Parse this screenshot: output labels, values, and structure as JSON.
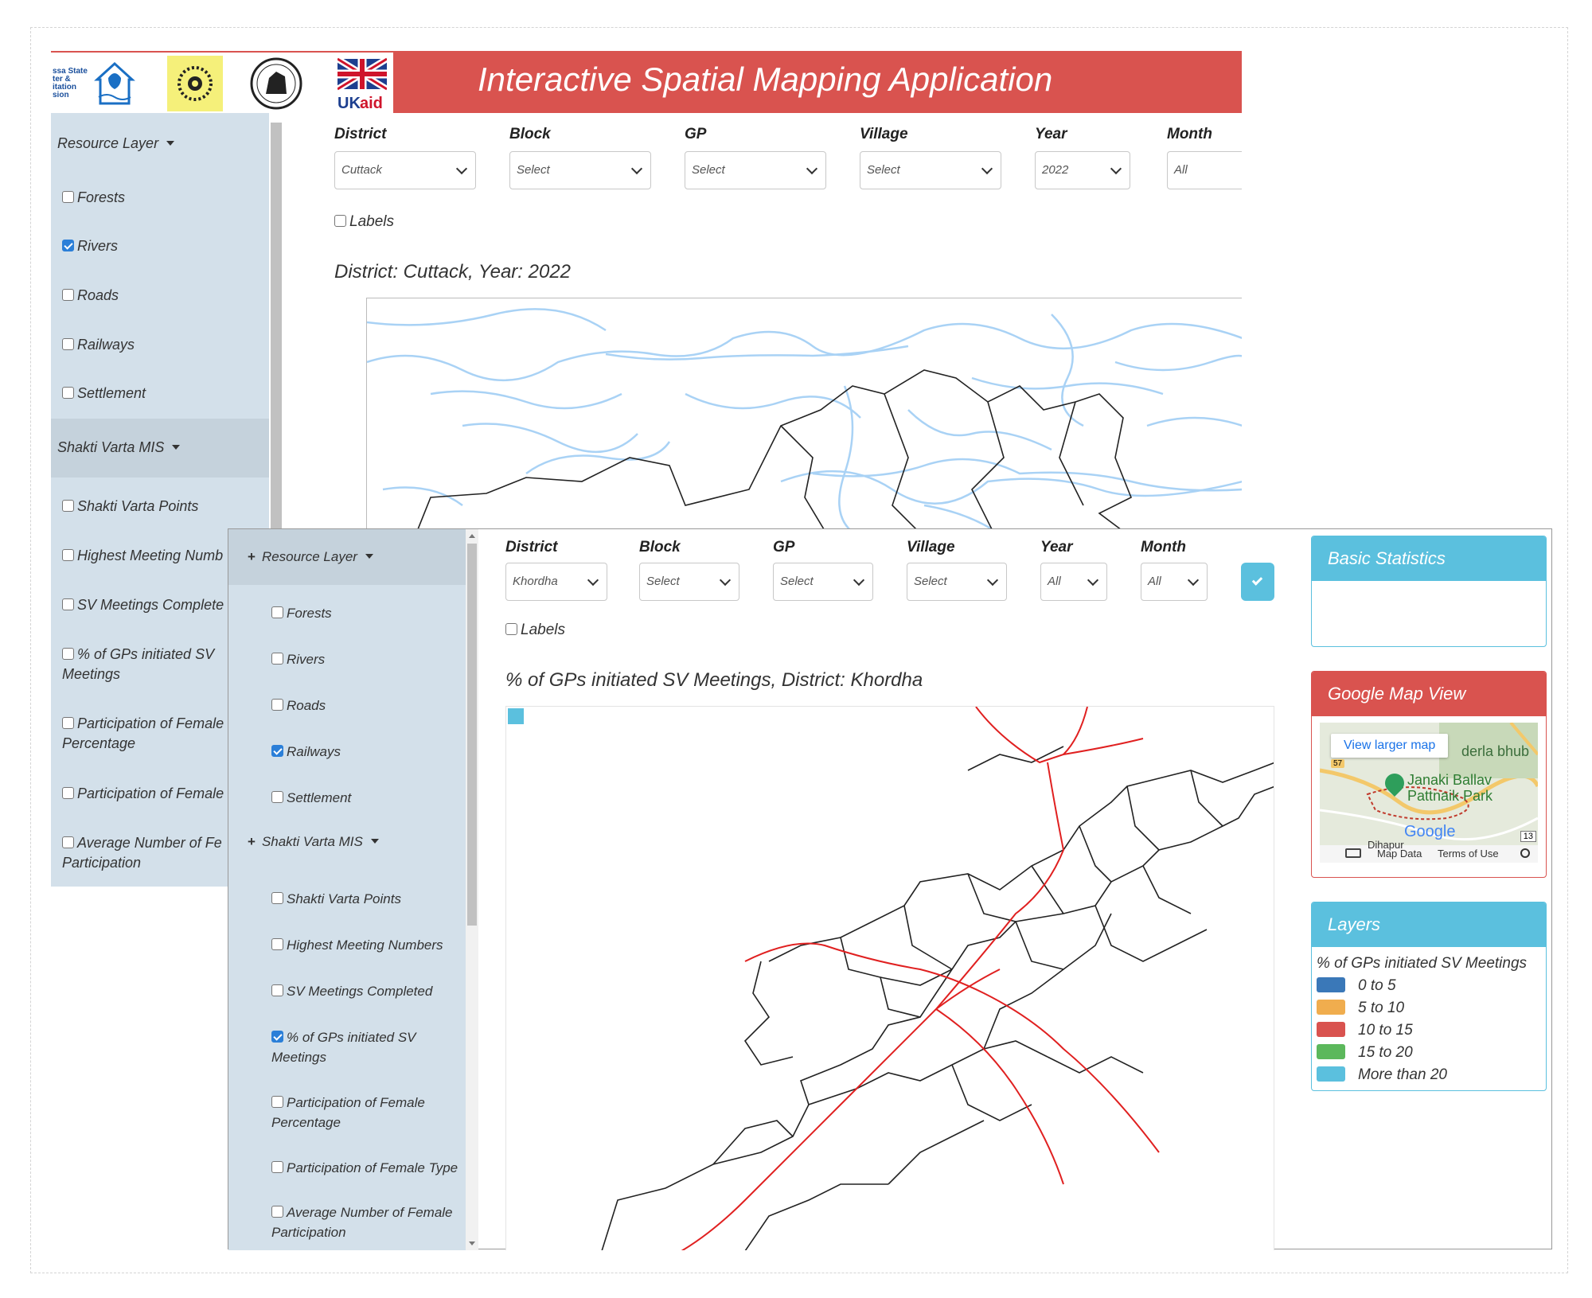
{
  "app": {
    "title": "Interactive Spatial Mapping Application",
    "logo_text": "ssa State ter & itation sion",
    "ukaid_text": "UKaid"
  },
  "back": {
    "filters": {
      "labels": [
        "District",
        "Block",
        "GP",
        "Village",
        "Year",
        "Month"
      ],
      "values": [
        "Cuttack",
        "Select",
        "Select",
        "Select",
        "2022",
        "All"
      ]
    },
    "labels_toggle": "Labels",
    "map_title": "District: Cuttack, Year: 2022",
    "sidebar": {
      "resource_header": "Resource Layer",
      "resource_items": [
        "Forests",
        "Rivers",
        "Roads",
        "Railways",
        "Settlement"
      ],
      "shakti_header": "Shakti Varta MIS",
      "shakti_items": [
        "Shakti Varta Points",
        "Highest Meeting Numb",
        "SV Meetings Complete",
        "% of GPs initiated SV",
        "Meetings",
        "Participation of Female",
        "Percentage",
        "Participation of Female",
        "Average Number of Fe",
        "Participation"
      ]
    }
  },
  "front": {
    "filters": {
      "labels": [
        "District",
        "Block",
        "GP",
        "Village",
        "Year",
        "Month"
      ],
      "values": [
        "Khordha",
        "Select",
        "Select",
        "Select",
        "All",
        "All"
      ]
    },
    "labels_toggle": "Labels",
    "map_title": "% of GPs initiated SV Meetings, District: Khordha",
    "sidebar": {
      "resource_header": "Resource Layer",
      "resource_items": [
        "Forests",
        "Rivers",
        "Roads",
        "Railways",
        "Settlement"
      ],
      "shakti_header": "Shakti Varta MIS",
      "shakti_items": [
        "Shakti Varta Points",
        "Highest Meeting Numbers",
        "SV Meetings Completed",
        "% of GPs initiated SV",
        "Meetings",
        "Participation of Female",
        "Percentage",
        "Participation of Female Type",
        "Average Number of Female",
        "Participation"
      ]
    },
    "stats": {
      "title": "Basic Statistics"
    },
    "gmap": {
      "title": "Google Map View",
      "view_larger": "View larger map",
      "place1": "derla bhub",
      "place2": "Janaki Ballav",
      "place3": "Pattnaik Park",
      "google": "Google",
      "place4": "Dihapur",
      "map_data": "Map Data",
      "terms": "Terms of Use",
      "road1": "57",
      "road2": "13"
    },
    "layers": {
      "title": "Layers",
      "subtitle": "% of GPs initiated SV Meetings",
      "items": [
        {
          "label": "0 to 5",
          "color": "#3a78b8"
        },
        {
          "label": "5 to 10",
          "color": "#f0ad4e"
        },
        {
          "label": "10 to 15",
          "color": "#d9534f"
        },
        {
          "label": "15 to 20",
          "color": "#5cb85c"
        },
        {
          "label": "More than 20",
          "color": "#5bc0de"
        }
      ]
    }
  },
  "colors": {
    "header_red": "#d9534f",
    "panel_blue": "#5bc0de",
    "sidebar": "#d3e0ea",
    "river": "#a9d2f5",
    "rail": "#e02020"
  }
}
